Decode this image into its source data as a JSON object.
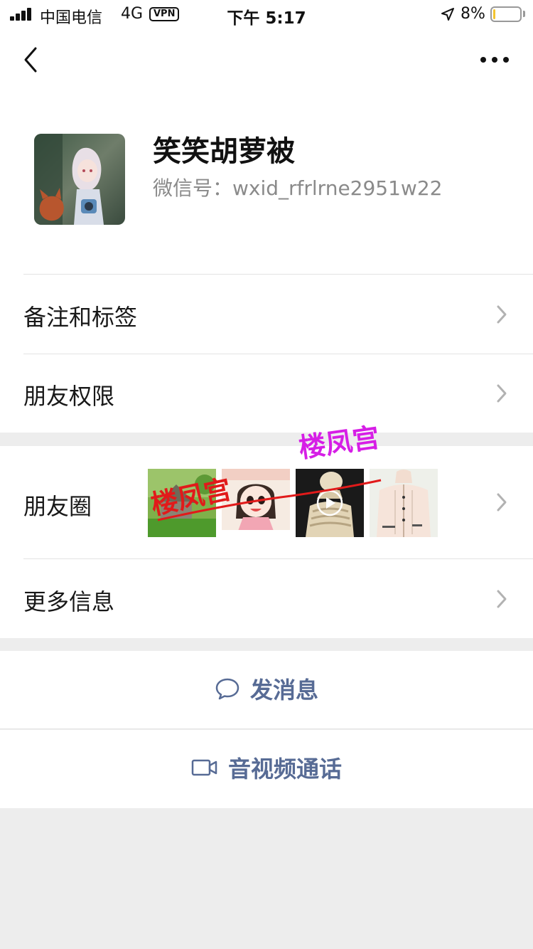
{
  "status_bar": {
    "carrier": "中国电信",
    "network": "4G",
    "vpn": "VPN",
    "time": "下午 5:17",
    "battery_percent": "8%",
    "battery_level": 0.08
  },
  "profile": {
    "name": "笑笑胡萝被",
    "wechat_id": "微信号：wxid_rfrlrne2951w22"
  },
  "menu": {
    "remark_tags": "备注和标签",
    "friend_permissions": "朋友权限",
    "moments": "朋友圈",
    "more_info": "更多信息"
  },
  "moments_watermark": {
    "left": "楼凤宫",
    "top": "楼凤宫"
  },
  "actions": {
    "send_message": "发消息",
    "video_call": "音视频通话"
  },
  "colors": {
    "link_blue": "#576b95",
    "watermark_red": "#e11a1a",
    "watermark_magenta": "#d61ee6"
  }
}
